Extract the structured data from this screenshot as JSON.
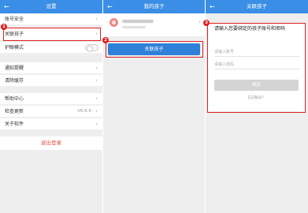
{
  "panel1": {
    "title": "设置",
    "back_icon": "arrow-left-icon",
    "items": [
      {
        "label": "账号安全"
      },
      {
        "label": "关联孩子"
      },
      {
        "label": "护眼模式"
      },
      {
        "label": "通知提醒"
      },
      {
        "label": "清除缓存"
      },
      {
        "label": "帮助中心"
      },
      {
        "label": "检查更新",
        "value": "V6.6.6"
      },
      {
        "label": "关于软件"
      }
    ],
    "logout": "退出登录",
    "badge": "1"
  },
  "panel2": {
    "title": "我的孩子",
    "button": "关联孩子",
    "badge": "2"
  },
  "panel3": {
    "title": "关联孩子",
    "form_title": "请输入您要绑定的孩子账号和密码",
    "account_placeholder": "请输入账号",
    "password_placeholder": "请输入密码",
    "submit": "绑定",
    "forgot": "忘记账号？",
    "badge": "3"
  },
  "colors": {
    "header_blue": "#3a8ee6",
    "button_blue": "#2f80d9",
    "highlight_red": "#e02020",
    "logout_red": "#e74c3c"
  }
}
